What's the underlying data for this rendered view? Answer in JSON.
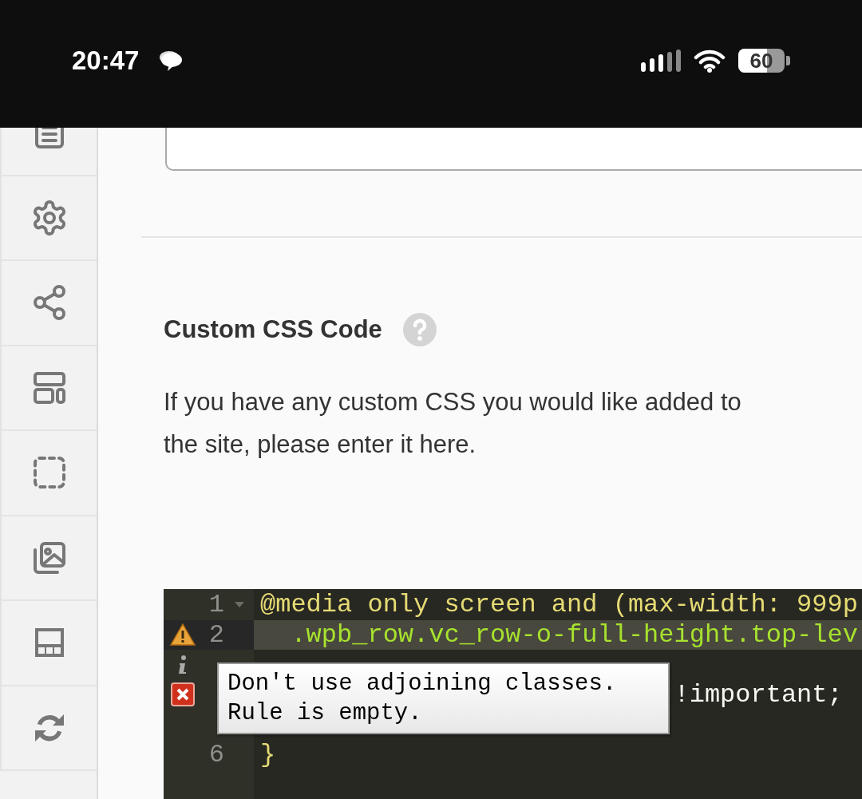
{
  "status_bar": {
    "time": "20:47",
    "battery": "60"
  },
  "sidebar": {
    "items": [
      {
        "kind": "document"
      },
      {
        "kind": "settings"
      },
      {
        "kind": "share"
      },
      {
        "kind": "layout"
      },
      {
        "kind": "dashed"
      },
      {
        "kind": "gallery"
      },
      {
        "kind": "footer"
      },
      {
        "kind": "refresh"
      }
    ]
  },
  "section": {
    "title": "Custom CSS Code",
    "description_lines": [
      "If you have any custom CSS you would like added to",
      "the site, please enter it here."
    ]
  },
  "editor": {
    "lines": [
      {
        "number": "1",
        "code": {
          "kind": "at-rule",
          "text": "@media only screen and (max-width: 999p"
        },
        "fold": true,
        "kind": "plain",
        "active": false
      },
      {
        "number": "2",
        "code": {
          "kind": "selector",
          "text": "  .wpb_row.vc_row-o-full-height.top-lev"
        },
        "fold": false,
        "kind": "warning",
        "active": true
      },
      {
        "kind": "info",
        "active": false
      },
      {
        "code": {
          "kind": "value",
          "text": "                           !important;"
        },
        "kind": "error",
        "active": false
      },
      {
        "kind": "plain",
        "active": false
      },
      {
        "number": "6",
        "code": {
          "kind": "at-rule",
          "text": "}"
        },
        "fold": false,
        "kind": "plain",
        "active": false
      }
    ],
    "tooltip": {
      "messages": [
        "Don't use adjoining classes.",
        "Rule is empty."
      ]
    }
  }
}
